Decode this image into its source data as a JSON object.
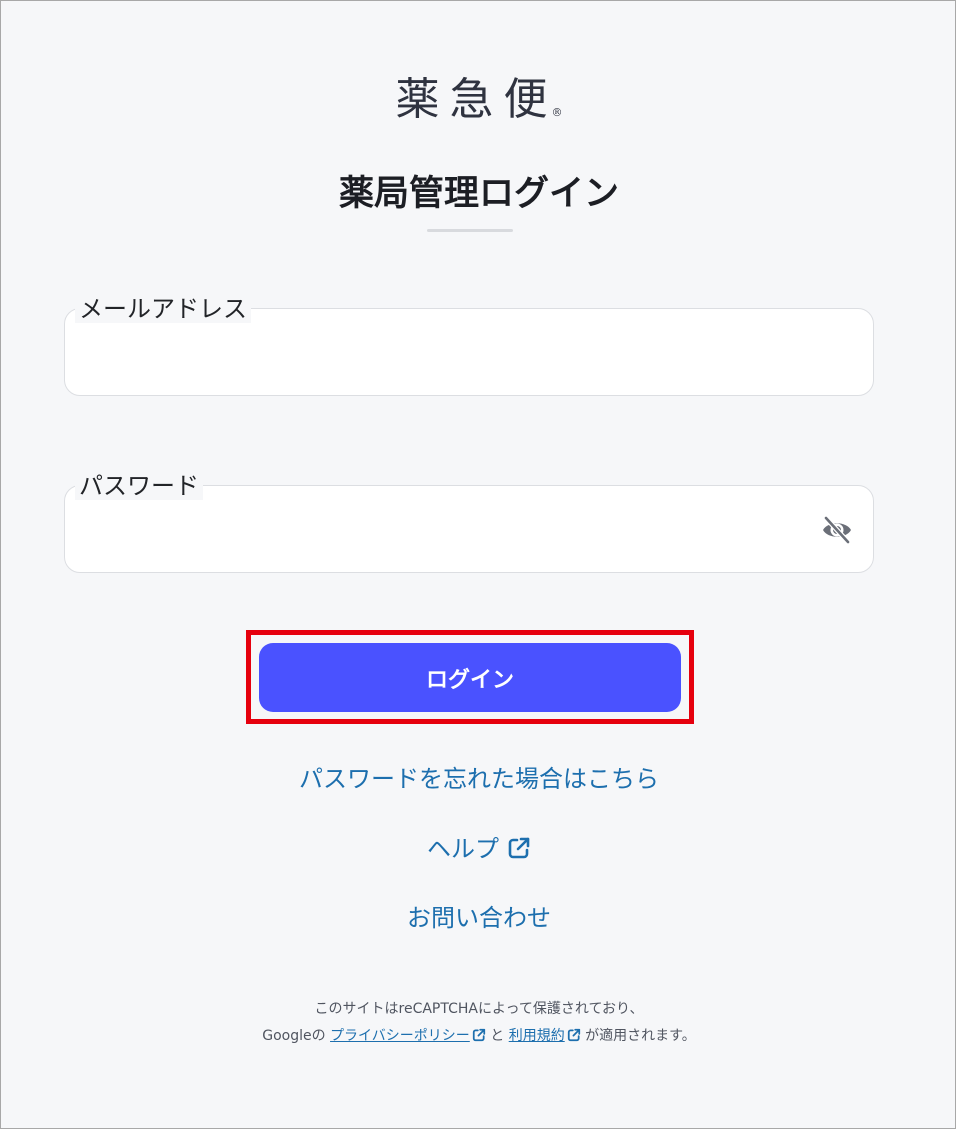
{
  "logo": {
    "text": "薬急便",
    "mark": "®"
  },
  "page_title": "薬局管理ログイン",
  "email_field": {
    "label": "メールアドレス",
    "value": "",
    "placeholder": ""
  },
  "password_field": {
    "label": "パスワード",
    "value": "",
    "placeholder": "",
    "toggle_icon": "eye-off-icon"
  },
  "login_button": {
    "label": "ログイン"
  },
  "links": {
    "forgot_password": "パスワードを忘れた場合はこちら",
    "help": "ヘルプ",
    "contact": "お問い合わせ"
  },
  "recaptcha": {
    "line1": "このサイトはreCAPTCHAによって保護されており、",
    "google": "Googleの",
    "privacy_link": "プライバシーポリシー",
    "and": "と",
    "terms_link": "利用規約",
    "suffix": "が適用されます。"
  },
  "colors": {
    "accent": "#4a52ff",
    "link": "#1d6fae",
    "highlight_border": "#e6000e",
    "background": "#f6f7f9"
  }
}
